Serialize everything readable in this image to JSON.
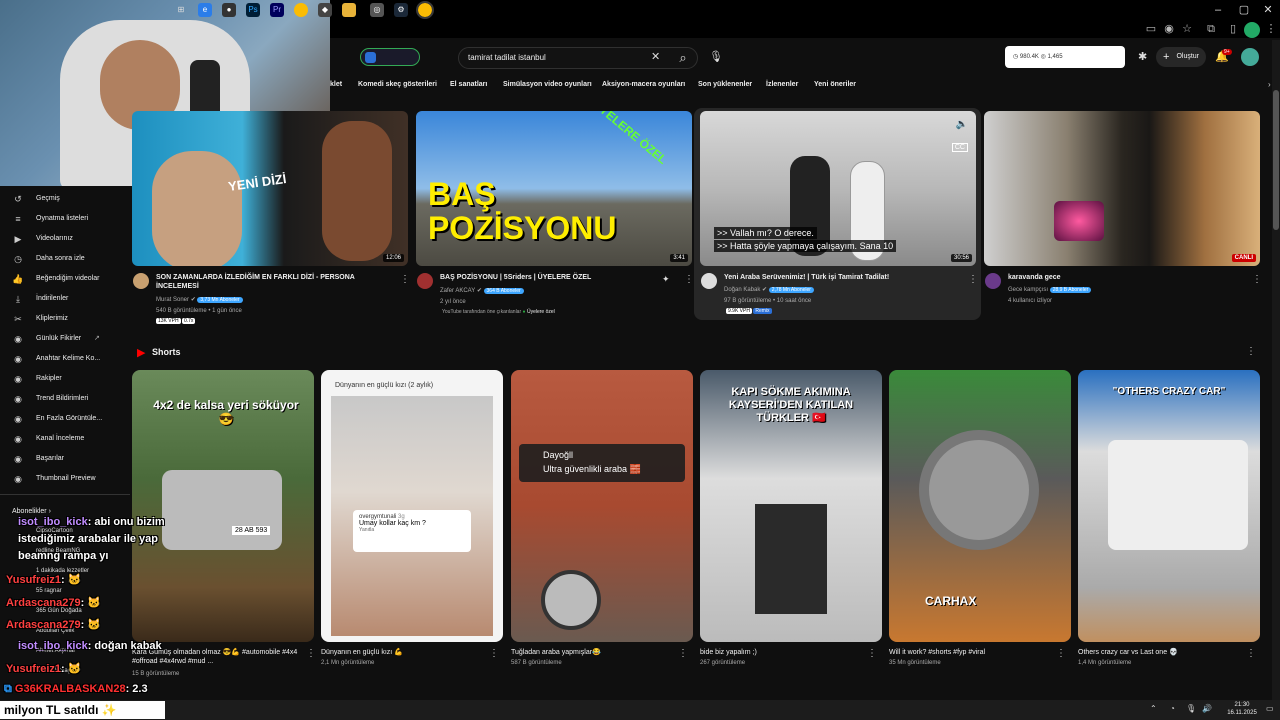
{
  "header": {
    "search_value": "tamirat tadilat istanbul",
    "stats_views": "980.4K",
    "stats_likes": "1,465",
    "create_label": "Oluştur",
    "notif_count": "9+"
  },
  "chips": [
    "klet",
    "Komedi skeç gösterileri",
    "El sanatları",
    "Simülasyon video oyunları",
    "Aksiyon-macera oyunları",
    "Son yüklenenler",
    "İzlenenler",
    "Yeni öneriler"
  ],
  "sidebar": {
    "items": [
      {
        "label": "Geçmiş",
        "icon": "history-icon"
      },
      {
        "label": "Oynatma listeleri",
        "icon": "playlist-icon"
      },
      {
        "label": "Videolarınız",
        "icon": "your-videos-icon"
      },
      {
        "label": "Daha sonra izle",
        "icon": "watch-later-icon"
      },
      {
        "label": "Beğendiğim videolar",
        "icon": "liked-icon"
      },
      {
        "label": "İndirilenler",
        "icon": "download-icon"
      },
      {
        "label": "Kliplerimiz",
        "icon": "clips-icon"
      },
      {
        "label": "Günlük Fikirler",
        "icon": "ext-icon"
      },
      {
        "label": "Anahtar Kelime Ko...",
        "icon": "ext-icon"
      },
      {
        "label": "Rakipler",
        "icon": "ext-icon"
      },
      {
        "label": "Trend Bildirimleri",
        "icon": "ext-icon"
      },
      {
        "label": "En Fazla Görüntüle...",
        "icon": "ext-icon"
      },
      {
        "label": "Kanal İnceleme",
        "icon": "ext-icon"
      },
      {
        "label": "Başarılar",
        "icon": "ext-icon"
      },
      {
        "label": "Thumbnail Preview",
        "icon": "ext-icon"
      }
    ],
    "subs_heading": "Abonelikler",
    "subs": [
      "CipsoCartoon",
      "redline BeamNG",
      "1 dakikada lezzetler",
      "55 ragnar",
      "365 Gün Doğada",
      "Abdullah Çelik",
      "Ahmet Akpınar",
      "Ahmet Karagöz"
    ]
  },
  "videos": [
    {
      "title": "SON ZAMANLARDA İZLEDİĞİM EN FARKLI DİZİ - PERSONA İNCELEMESİ",
      "channel": "Murat Soner",
      "subs": "3,73 Mn Aboneler",
      "meta": "540 B görüntüleme • 1 gün önce",
      "badges": [
        "13K VPH",
        "0.7x"
      ],
      "duration": "12:06",
      "thumb_text": "YENİ DİZİ"
    },
    {
      "title": "BAŞ POZİSYONU | 5Sriders | ÜYELERE ÖZEL",
      "channel": "Zafer AKCAY",
      "subs": "364 B Aboneler",
      "meta": "2 yıl önce",
      "extra": "YouTube tarafından öne çıkarılanlar",
      "members": "Üyelere özel",
      "duration": "3:41",
      "thumb_text": "BAŞ POZİSYONU",
      "thumb_tag": "ÜYELERE ÖZEL"
    },
    {
      "title": "Yeni Araba Serüvenimiz! | Türk işi Tamirat Tadilat!",
      "channel": "Doğan Kabak",
      "subs": "2,78 Mn Aboneler",
      "meta": "97 B görüntüleme • 10 saat önce",
      "badges": [
        "9.9K VPH",
        "Remix"
      ],
      "duration": "30:56",
      "caption1": ">> Vallah mı? O derece.",
      "caption2": ">> Hatta şöyle yapmaya çalışayım. Sana 10"
    },
    {
      "title": "karavanda gece",
      "channel": "Gece kampçısı",
      "subs": "28,9 B Aboneler",
      "meta": "4 kullanıcı izliyor",
      "live": "CANLI"
    }
  ],
  "shorts": {
    "heading": "Shorts",
    "items": [
      {
        "title": "Kara Gümüş olmadan olmaz 😎💪 #automobile #4x4 #offroad #4x4rwd #mud ...",
        "views": "15 B görüntüleme",
        "overlay": "4x2 de kalsa yeri söküyor 😎",
        "plate": "28 AB 593"
      },
      {
        "title": "Dünyanın en güçlü kızı 💪",
        "views": "2,1 Mn görüntüleme",
        "overlay": "Dünyanın en güçlü kızı (2 aylık)",
        "comment_user": "overgymtunali",
        "comment_age": "3g",
        "comment_text": "Umay kollar kaç km ?",
        "comment_reply": "Yanıtla"
      },
      {
        "title": "Tuğladan araba yapmışlar😂",
        "views": "587 B görüntüleme",
        "comment_user": "Dayoğll",
        "comment_text": "Ultra güvenlikli araba 🧱"
      },
      {
        "title": "bide biz yapalım ;)",
        "views": "267 görüntüleme",
        "overlay": "KAPI SÖKME AKIMINA KAYSERİ'DEN KATILAN TÜRKLER 🇹🇷"
      },
      {
        "title": "Will it work? #shorts #fyp #viral",
        "views": "35 Mn görüntüleme",
        "overlay": "CARHAX"
      },
      {
        "title": "Others crazy car vs Last one 💀",
        "views": "1,4 Mn görüntüleme",
        "overlay": "\"OTHERS CRAZY CAR\""
      }
    ]
  },
  "chat": [
    {
      "user": "isot_ibo_kick",
      "text": ": abi onu bizim istediğimiz arabalar ile yap beamng rampa yı",
      "color": "#c08cff"
    },
    {
      "user": "Yusufreiz1",
      "text": ": 🐱",
      "color": "#ff4040"
    },
    {
      "user": "Ardascana279",
      "text": ": 🐱",
      "color": "#ff4040"
    },
    {
      "user": "Ardascana279",
      "text": ": 🐱",
      "color": "#ff4040"
    },
    {
      "user": "isot_ibo_kick",
      "text": ": doğan kabak",
      "color": "#c08cff"
    },
    {
      "user": "Yusufreiz1",
      "text": ": 🐱",
      "color": "#ff4040"
    },
    {
      "user": "G36KRALBASKAN28",
      "text": ": 2.3",
      "color": "#ff3030"
    }
  ],
  "ticker": "milyon TL satıldı",
  "clock": {
    "time": "21:30",
    "date": "16.11.2025"
  }
}
